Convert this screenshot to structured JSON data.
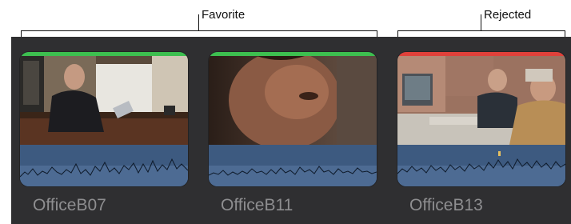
{
  "annotations": {
    "favorite_label": "Favorite",
    "rejected_label": "Rejected"
  },
  "clips": [
    {
      "name": "OfficeB07",
      "rating": "favorite",
      "rating_color": "#3dbf4f"
    },
    {
      "name": "OfficeB11",
      "rating": "favorite",
      "rating_color": "#3dbf4f"
    },
    {
      "name": "OfficeB13",
      "rating": "rejected",
      "rating_color": "#e0413a"
    }
  ],
  "colors": {
    "panel_bg": "#2f2f31",
    "audio_waveform_bg": "#3d5a80",
    "audio_waveform_line": "#0e1a2a",
    "clip_name": "#8e8e90",
    "favorite": "#3dbf4f",
    "rejected": "#e0413a"
  }
}
